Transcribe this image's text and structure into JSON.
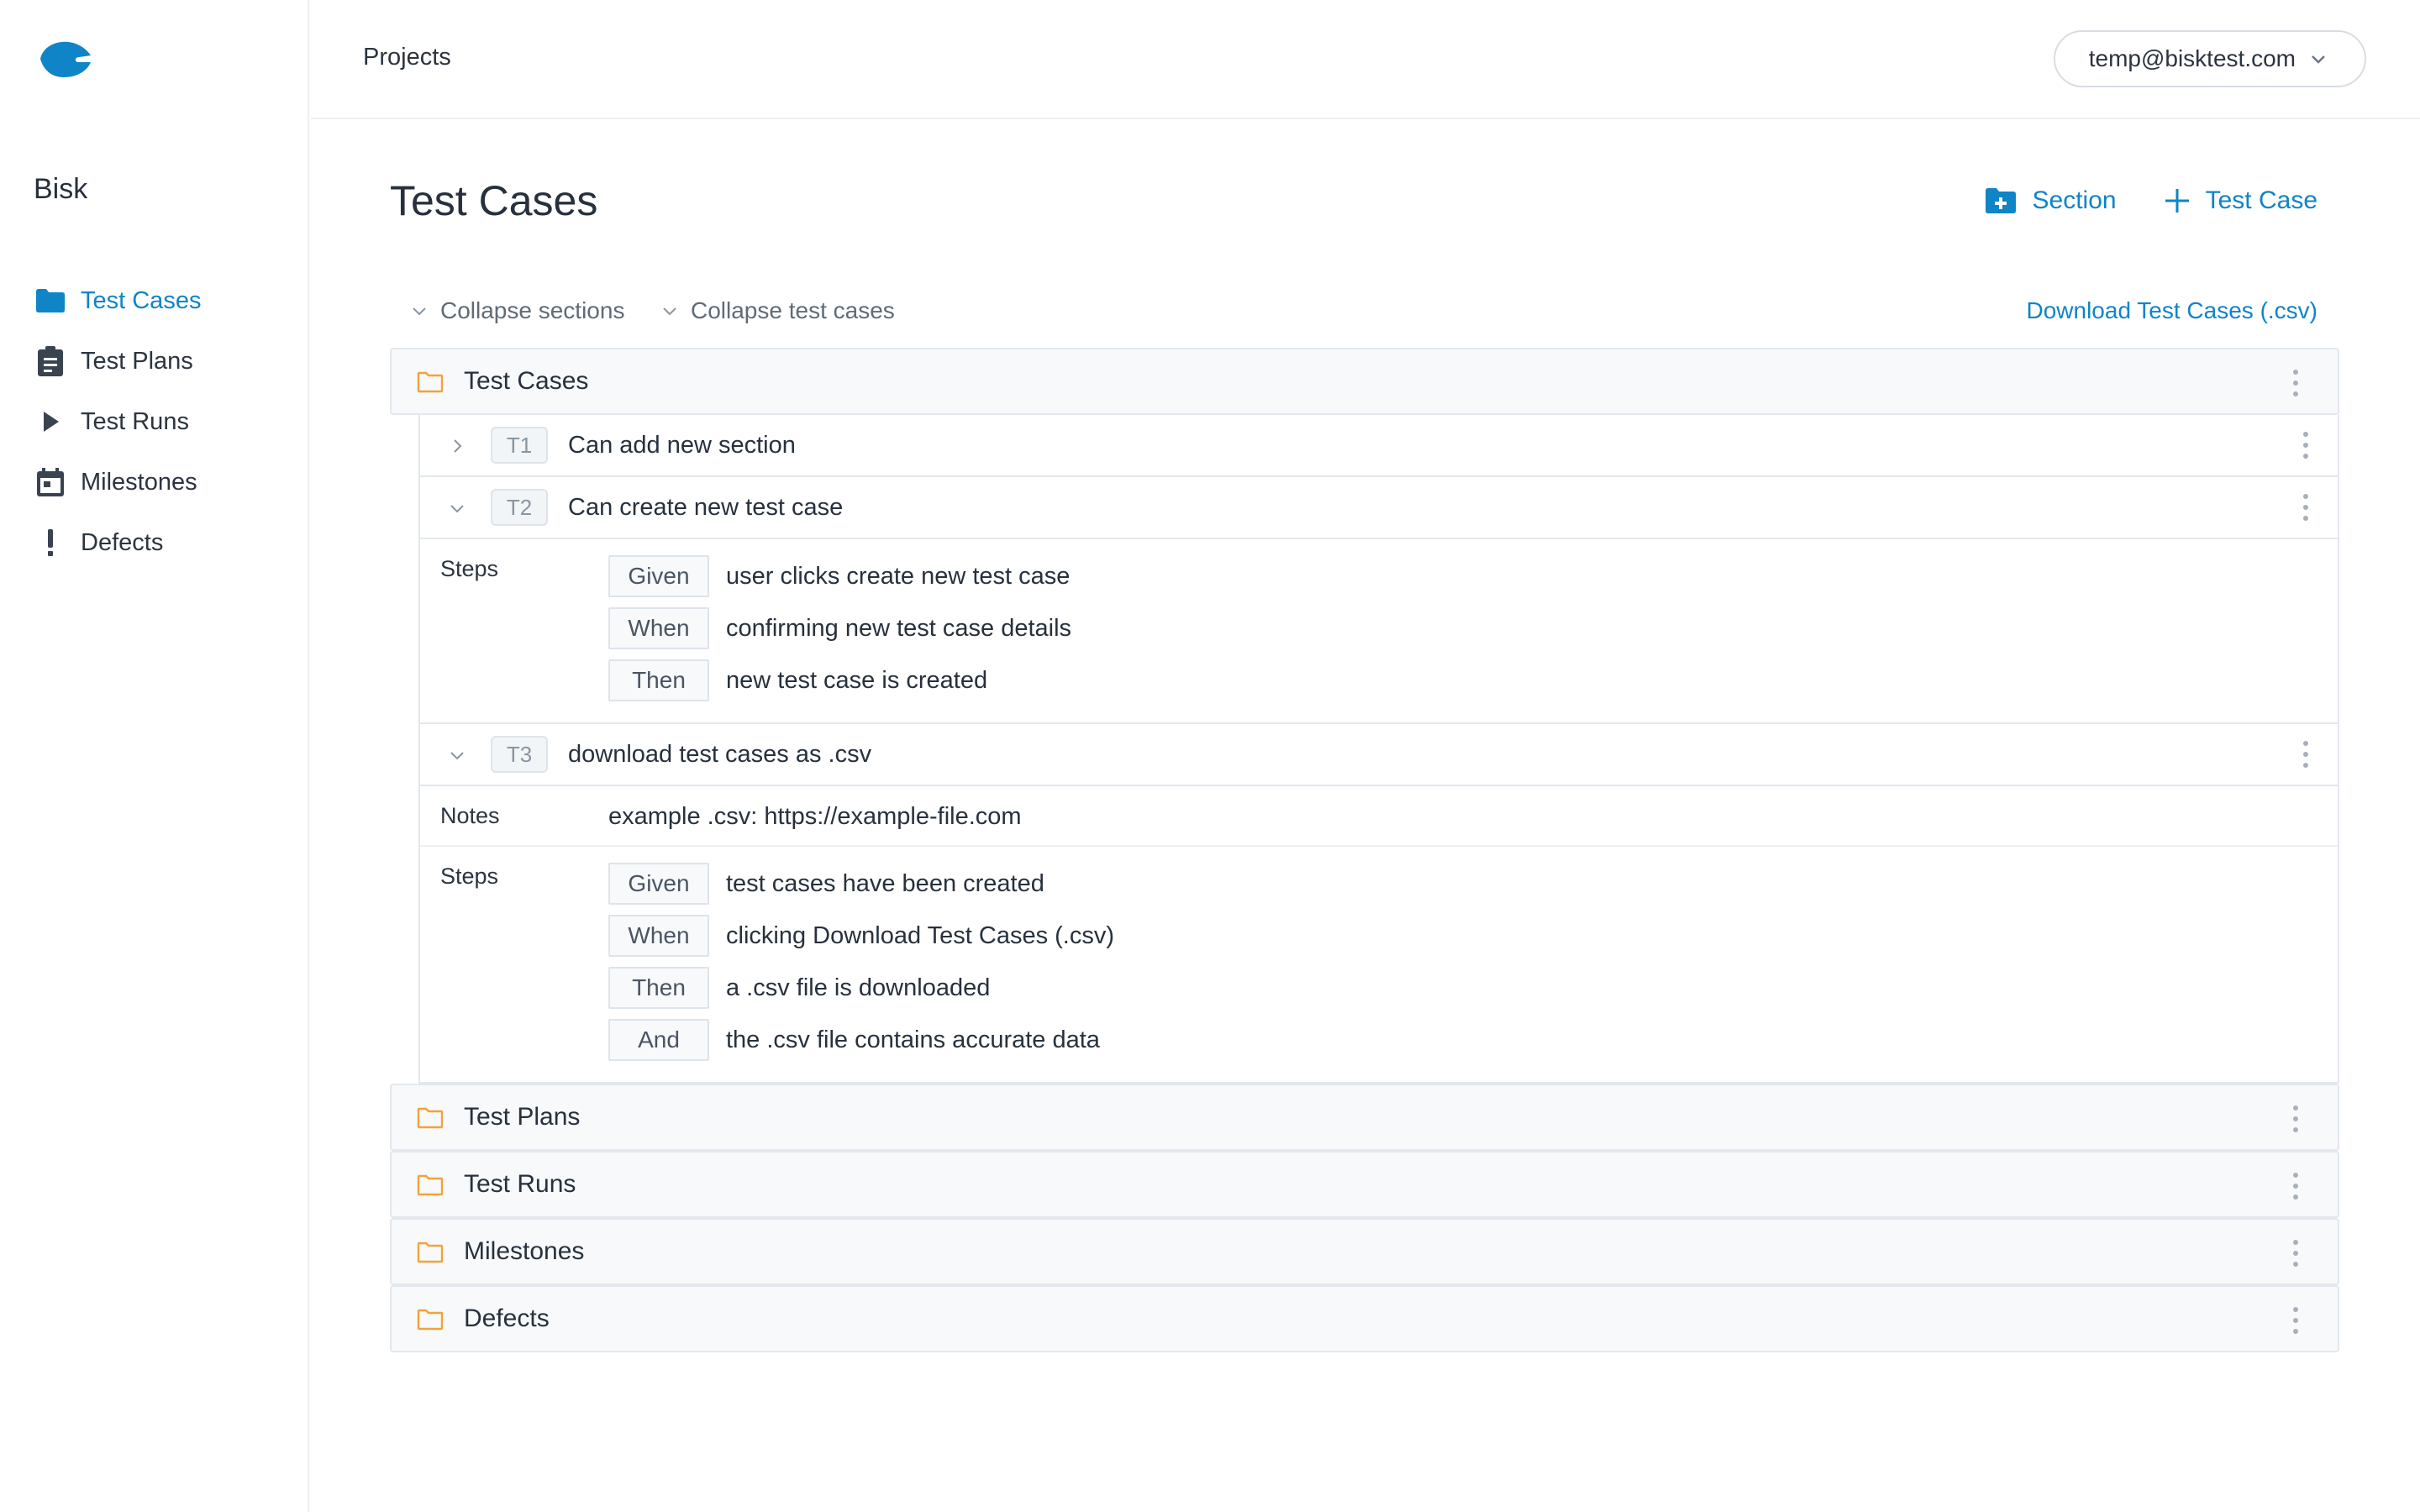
{
  "app": {
    "brand_color": "#0f84c7",
    "folder_color": "#f2a33a",
    "project_name": "Bisk"
  },
  "sidebar": {
    "items": [
      {
        "label": "Test Cases",
        "icon": "folder-icon",
        "active": true
      },
      {
        "label": "Test Plans",
        "icon": "clipboard-icon",
        "active": false
      },
      {
        "label": "Test Runs",
        "icon": "play-icon",
        "active": false
      },
      {
        "label": "Milestones",
        "icon": "calendar-icon",
        "active": false
      },
      {
        "label": "Defects",
        "icon": "exclamation-icon",
        "active": false
      }
    ]
  },
  "topbar": {
    "breadcrumb": "Projects",
    "user_email": "temp@bisktest.com"
  },
  "main": {
    "title": "Test Cases",
    "add_section_label": "Section",
    "add_test_case_label": "Test Case",
    "collapse_sections_label": "Collapse sections",
    "collapse_test_cases_label": "Collapse test cases",
    "download_label": "Download Test Cases (.csv)"
  },
  "sections": [
    {
      "name": "Test Cases",
      "cases": [
        {
          "id": "T1",
          "title": "Can add new section",
          "expanded": false
        },
        {
          "id": "T2",
          "title": "Can create new test case",
          "expanded": true,
          "steps_label": "Steps",
          "steps": [
            {
              "keyword": "Given",
              "text": "user clicks create new test case"
            },
            {
              "keyword": "When",
              "text": "confirming new test case details"
            },
            {
              "keyword": "Then",
              "text": "new test case is created"
            }
          ]
        },
        {
          "id": "T3",
          "title": "download test cases as .csv",
          "expanded": true,
          "notes_label": "Notes",
          "notes": "example .csv: https://example-file.com",
          "steps_label": "Steps",
          "steps": [
            {
              "keyword": "Given",
              "text": "test cases have been created"
            },
            {
              "keyword": "When",
              "text": "clicking Download Test Cases (.csv)"
            },
            {
              "keyword": "Then",
              "text": "a .csv file is downloaded"
            },
            {
              "keyword": "And",
              "text": "the .csv file contains accurate data"
            }
          ]
        }
      ]
    },
    {
      "name": "Test Plans"
    },
    {
      "name": "Test Runs"
    },
    {
      "name": "Milestones"
    },
    {
      "name": "Defects"
    }
  ]
}
